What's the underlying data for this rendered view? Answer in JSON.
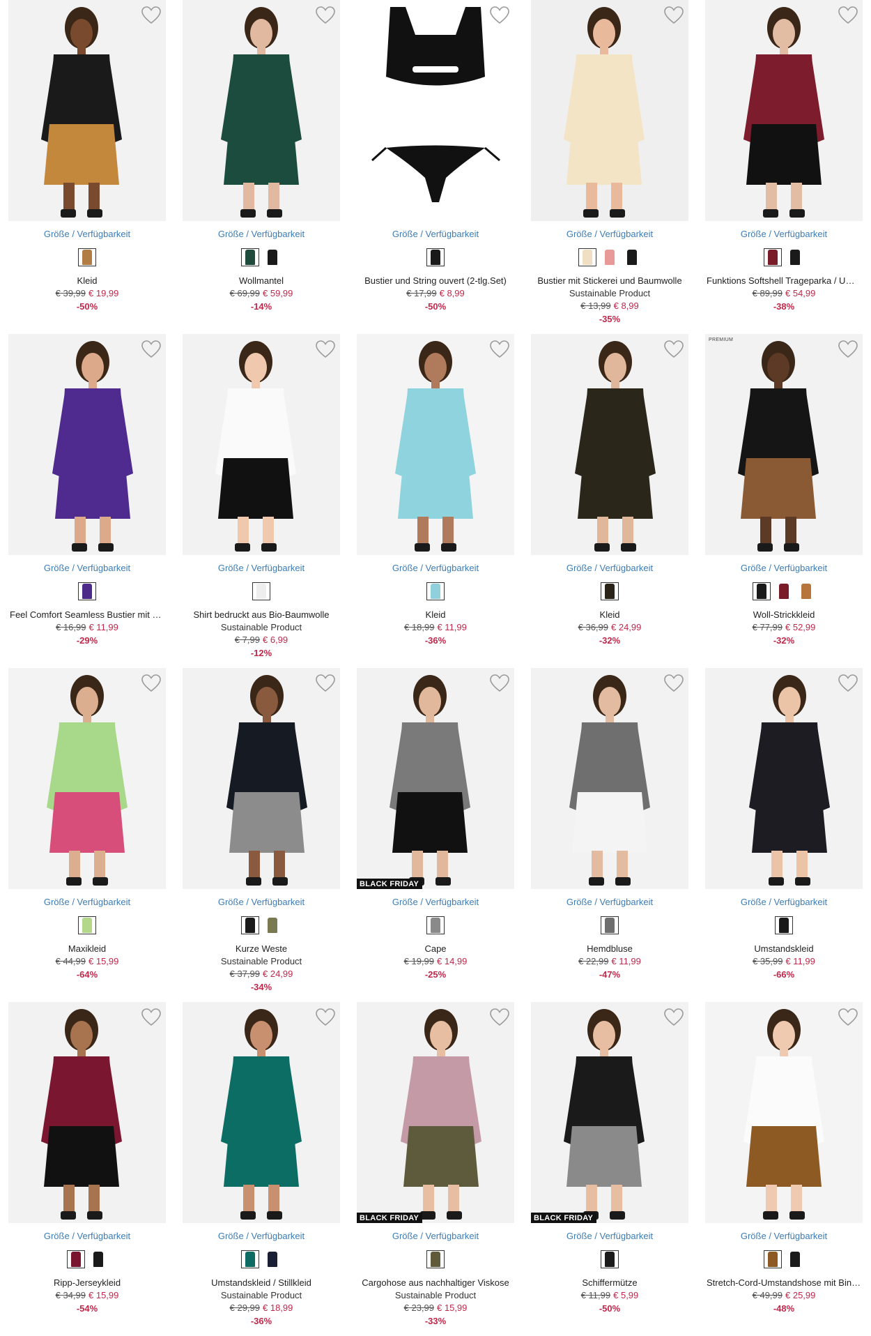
{
  "labels": {
    "sizes_link": "Größe / Verfügbarkeit",
    "black_friday": "BLACK FRIDAY",
    "premium": "PREMIUM",
    "heart_icon": "heart-outline-icon"
  },
  "colors": {
    "link": "#3d7cb6",
    "sale": "#c0284b",
    "badge_bg": "#111111"
  },
  "products": [
    {
      "name": "Kleid",
      "subtitle": "",
      "old_price": "€ 39,99",
      "new_price": "€ 19,99",
      "discount": "-50%",
      "badge": "",
      "premium": false,
      "swatches": [
        "#b27d45"
      ],
      "bg": "#f2f2f2",
      "top": "#1a1a1a",
      "bottom": "#c4883c",
      "skin": "#7a4a2e"
    },
    {
      "name": "Wollmantel",
      "subtitle": "",
      "old_price": "€ 69,99",
      "new_price": "€ 59,99",
      "discount": "-14%",
      "badge": "",
      "premium": false,
      "swatches": [
        "#1f4a3c",
        "#1a1a1a"
      ],
      "bg": "#f2f2f2",
      "top": "#1c4c3e",
      "bottom": "#1c4c3e",
      "skin": "#e0b9a0"
    },
    {
      "name": "Bustier und String ouvert (2-tlg.Set)",
      "subtitle": "",
      "old_price": "€ 17,99",
      "new_price": "€ 8,99",
      "discount": "-50%",
      "badge": "",
      "premium": false,
      "swatches": [
        "#1a1a1a"
      ],
      "bg": "#ffffff",
      "top": "#111111",
      "bottom": "#111111",
      "skin": "none"
    },
    {
      "name": "Bustier mit Stickerei und Baumwolle",
      "subtitle": "Sustainable Product",
      "old_price": "€ 13,99",
      "new_price": "€ 8,99",
      "discount": "-35%",
      "badge": "",
      "premium": false,
      "swatches": [
        "#f1dfc3",
        "#e79a97",
        "#1a1a1a"
      ],
      "bg": "#efefef",
      "top": "#f3e4c6",
      "bottom": "#f3e4c6",
      "skin": "#e8b99b"
    },
    {
      "name": "Funktions Softshell Trageparka / Umstandsparka",
      "subtitle": "",
      "old_price": "€ 89,99",
      "new_price": "€ 54,99",
      "discount": "-38%",
      "badge": "",
      "premium": false,
      "swatches": [
        "#7a1b2a",
        "#1a1a1a"
      ],
      "bg": "#f2f2f2",
      "top": "#7c1c2c",
      "bottom": "#111111",
      "skin": "#e3bda3"
    },
    {
      "name": "Feel Comfort Seamless Bustier mit Slip",
      "subtitle": "",
      "old_price": "€ 16,99",
      "new_price": "€ 11,99",
      "discount": "-29%",
      "badge": "",
      "premium": false,
      "swatches": [
        "#4b2a8a"
      ],
      "bg": "#f2f2f2",
      "top": "#4f2a8f",
      "bottom": "#4f2a8f",
      "skin": "#dca98a"
    },
    {
      "name": "Shirt bedruckt aus Bio-Baumwolle",
      "subtitle": "Sustainable Product",
      "old_price": "€ 7,99",
      "new_price": "€ 6,99",
      "discount": "-12%",
      "badge": "",
      "premium": false,
      "swatches": [
        "#eeeeee"
      ],
      "bg": "#f2f2f2",
      "top": "#fafafa",
      "bottom": "#111111",
      "skin": "#efc8ad"
    },
    {
      "name": "Kleid",
      "subtitle": "",
      "old_price": "€ 18,99",
      "new_price": "€ 11,99",
      "discount": "-36%",
      "badge": "",
      "premium": false,
      "swatches": [
        "#8fd0dc"
      ],
      "bg": "#f4f4f4",
      "top": "#8fd3df",
      "bottom": "#8fd3df",
      "skin": "#b07b5c"
    },
    {
      "name": "Kleid",
      "subtitle": "",
      "old_price": "€ 36,99",
      "new_price": "€ 24,99",
      "discount": "-32%",
      "badge": "",
      "premium": false,
      "swatches": [
        "#2a2418"
      ],
      "bg": "#f2f2f2",
      "top": "#2b261a",
      "bottom": "#2b261a",
      "skin": "#e1b79b"
    },
    {
      "name": "Woll-Strickkleid",
      "subtitle": "",
      "old_price": "€ 77,99",
      "new_price": "€ 52,99",
      "discount": "-32%",
      "badge": "",
      "premium": true,
      "swatches": [
        "#1a1a1a",
        "#7a1b2a",
        "#b6753a"
      ],
      "bg": "#f2f2f2",
      "top": "#151515",
      "bottom": "#8a5a34",
      "skin": "#5c3a26"
    },
    {
      "name": "Maxikleid",
      "subtitle": "",
      "old_price": "€ 44,99",
      "new_price": "€ 15,99",
      "discount": "-64%",
      "badge": "",
      "premium": false,
      "swatches": [
        "#b3d88b"
      ],
      "bg": "#f3f3f3",
      "top": "#a8d88a",
      "bottom": "#d84e7a",
      "skin": "#dcae90"
    },
    {
      "name": "Kurze Weste",
      "subtitle": "Sustainable Product",
      "old_price": "€ 37,99",
      "new_price": "€ 24,99",
      "discount": "-34%",
      "badge": "",
      "premium": false,
      "swatches": [
        "#1a1a1a",
        "#7a7a52"
      ],
      "bg": "#f2f2f2",
      "top": "#161a22",
      "bottom": "#8c8c8c",
      "skin": "#8a5a3e"
    },
    {
      "name": "Cape",
      "subtitle": "",
      "old_price": "€ 19,99",
      "new_price": "€ 14,99",
      "discount": "-25%",
      "badge": "BLACK FRIDAY",
      "premium": false,
      "swatches": [
        "#8a8a8a"
      ],
      "bg": "#f2f2f2",
      "top": "#7a7a7a",
      "bottom": "#111111",
      "skin": "#e1b89b"
    },
    {
      "name": "Hemdbluse",
      "subtitle": "",
      "old_price": "€ 22,99",
      "new_price": "€ 11,99",
      "discount": "-47%",
      "badge": "",
      "premium": false,
      "swatches": [
        "#6e6e6e"
      ],
      "bg": "#f2f2f2",
      "top": "#6f6f6f",
      "bottom": "#f4f4f4",
      "skin": "#e3bba0"
    },
    {
      "name": "Umstandskleid",
      "subtitle": "",
      "old_price": "€ 35,99",
      "new_price": "€ 11,99",
      "discount": "-66%",
      "badge": "",
      "premium": false,
      "swatches": [
        "#1a1a1a"
      ],
      "bg": "#f2f2f2",
      "top": "#1c1c22",
      "bottom": "#1c1c22",
      "skin": "#ebc4a8"
    },
    {
      "name": "Ripp-Jerseykleid",
      "subtitle": "",
      "old_price": "€ 34,99",
      "new_price": "€ 15,99",
      "discount": "-54%",
      "badge": "",
      "premium": false,
      "swatches": [
        "#7a1530",
        "#1a1a1a"
      ],
      "bg": "#f2f2f2",
      "top": "#7b1631",
      "bottom": "#111111",
      "skin": "#a8744f"
    },
    {
      "name": "Umstandskleid / Stillkleid",
      "subtitle": "Sustainable Product",
      "old_price": "€ 29,99",
      "new_price": "€ 18,99",
      "discount": "-36%",
      "badge": "",
      "premium": false,
      "swatches": [
        "#0d6b63",
        "#1a1f33"
      ],
      "bg": "#f2f2f2",
      "top": "#0b6d63",
      "bottom": "#0b6d63",
      "skin": "#c99070"
    },
    {
      "name": "Cargohose aus nachhaltiger Viskose",
      "subtitle": "Sustainable Product",
      "old_price": "€ 23,99",
      "new_price": "€ 15,99",
      "discount": "-33%",
      "badge": "BLACK FRIDAY",
      "premium": false,
      "swatches": [
        "#5f5a3a"
      ],
      "bg": "#f2f2f2",
      "top": "#c39aa6",
      "bottom": "#5e5a3c",
      "skin": "#e7bea2"
    },
    {
      "name": "Schiffermütze",
      "subtitle": "",
      "old_price": "€ 11,99",
      "new_price": "€ 5,99",
      "discount": "-50%",
      "badge": "BLACK FRIDAY",
      "premium": false,
      "swatches": [
        "#1a1a1a"
      ],
      "bg": "#f2f2f2",
      "top": "#1a1a1a",
      "bottom": "#8a8a8a",
      "skin": "#e7bea2"
    },
    {
      "name": "Stretch-Cord-Umstandshose mit Bindeband",
      "subtitle": "",
      "old_price": "€ 49,99",
      "new_price": "€ 25,99",
      "discount": "-48%",
      "badge": "",
      "premium": false,
      "swatches": [
        "#8c5a22",
        "#1a1a1a"
      ],
      "bg": "#f4f4f4",
      "top": "#fbfbfb",
      "bottom": "#8d5a24",
      "skin": "#efcab0"
    }
  ]
}
